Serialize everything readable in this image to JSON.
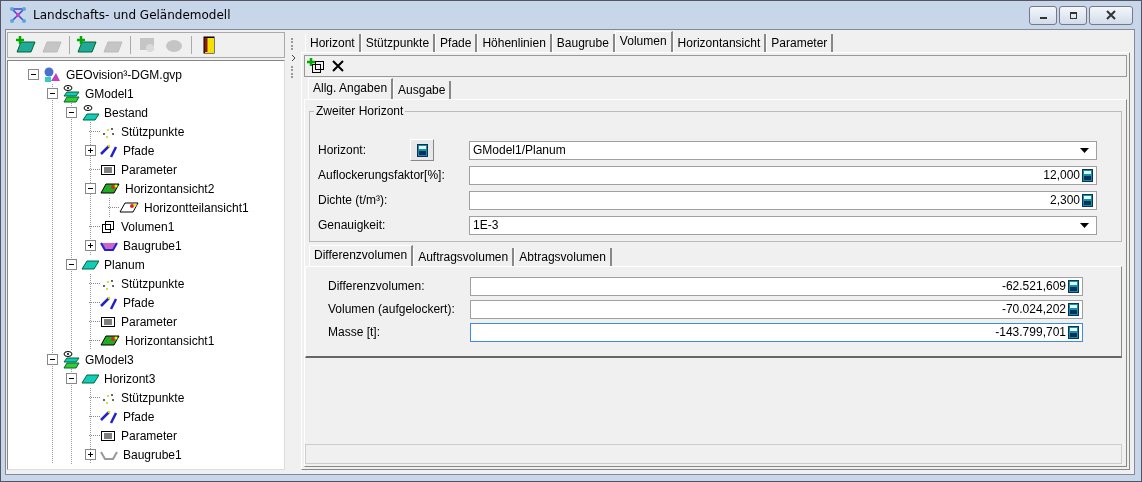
{
  "window": {
    "title": "Landschafts- und Geländemodell"
  },
  "tree_toolbar": [
    {
      "kind": "add-model",
      "disabled": false
    },
    {
      "kind": "remove-model",
      "disabled": true
    },
    {
      "kind": "add-horizon",
      "disabled": false
    },
    {
      "kind": "remove-horizon",
      "disabled": true
    },
    {
      "kind": "import",
      "disabled": true
    },
    {
      "kind": "globe",
      "disabled": true
    },
    {
      "kind": "exit",
      "disabled": false
    }
  ],
  "tree": [
    {
      "label": "GEOvision³-DGM.gvp",
      "kind": "project",
      "expanded": true,
      "children": [
        {
          "label": "GModel1",
          "kind": "model",
          "expanded": true,
          "children": [
            {
              "label": "Bestand",
              "kind": "horizon-visible",
              "expanded": true,
              "children": [
                {
                  "label": "Stützpunkte",
                  "kind": "points"
                },
                {
                  "label": "Pfade",
                  "kind": "paths",
                  "expanded": false
                },
                {
                  "label": "Parameter",
                  "kind": "parameter"
                },
                {
                  "label": "Horizontansicht2",
                  "kind": "view",
                  "expanded": true,
                  "children": [
                    {
                      "label": "Horizontteilansicht1",
                      "kind": "partview"
                    }
                  ]
                },
                {
                  "label": "Volumen1",
                  "kind": "volume"
                },
                {
                  "label": "Baugrube1",
                  "kind": "pit",
                  "expanded": false
                }
              ]
            },
            {
              "label": "Planum",
              "kind": "horizon",
              "expanded": true,
              "children": [
                {
                  "label": "Stützpunkte",
                  "kind": "points"
                },
                {
                  "label": "Pfade",
                  "kind": "paths"
                },
                {
                  "label": "Parameter",
                  "kind": "parameter"
                },
                {
                  "label": "Horizontansicht1",
                  "kind": "view"
                }
              ]
            }
          ]
        },
        {
          "label": "GModel3",
          "kind": "model",
          "expanded": true,
          "children": [
            {
              "label": "Horizont3",
              "kind": "horizon",
              "expanded": true,
              "children": [
                {
                  "label": "Stützpunkte",
                  "kind": "points"
                },
                {
                  "label": "Pfade",
                  "kind": "paths"
                },
                {
                  "label": "Parameter",
                  "kind": "parameter"
                },
                {
                  "label": "Baugrube1",
                  "kind": "pit-outline",
                  "expanded": false
                }
              ]
            }
          ]
        }
      ]
    }
  ],
  "tabs": [
    {
      "label": "Horizont",
      "selected": false
    },
    {
      "label": "Stützpunkte",
      "selected": false
    },
    {
      "label": "Pfade",
      "selected": false
    },
    {
      "label": "Höhenlinien",
      "selected": false
    },
    {
      "label": "Baugrube",
      "selected": false
    },
    {
      "label": "Volumen",
      "selected": true
    },
    {
      "label": "Horizontansicht",
      "selected": false
    },
    {
      "label": "Parameter",
      "selected": false
    }
  ],
  "toolbar": [
    {
      "kind": "add-volume"
    },
    {
      "kind": "delete"
    }
  ],
  "subtabs": [
    {
      "label": "Allg. Angaben",
      "selected": true
    },
    {
      "label": "Ausgabe",
      "selected": false
    }
  ],
  "group": {
    "title": "Zweiter Horizont",
    "fields": [
      {
        "label": "Horizont:",
        "value": "GModel1/Planum",
        "kind": "dropdown",
        "has_button": true
      },
      {
        "label": "Auflockerungsfaktor[%]:",
        "value": "12,000",
        "kind": "number"
      },
      {
        "label": "Dichte (t/m³):",
        "value": "2,300",
        "kind": "number"
      },
      {
        "label": "Genauigkeit:",
        "value": "1E-3",
        "kind": "dropdown"
      }
    ]
  },
  "result_tabs": [
    {
      "label": "Differenzvolumen",
      "selected": true
    },
    {
      "label": "Auftragsvolumen",
      "selected": false
    },
    {
      "label": "Abtragsvolumen",
      "selected": false
    }
  ],
  "results": [
    {
      "label": "Differenzvolumen:",
      "value": "-62.521,609",
      "focused": false
    },
    {
      "label": "Volumen (aufgelockert):",
      "value": "-70.024,202",
      "focused": false
    },
    {
      "label": "Masse [t]:",
      "value": "-143.799,701",
      "focused": true
    }
  ]
}
